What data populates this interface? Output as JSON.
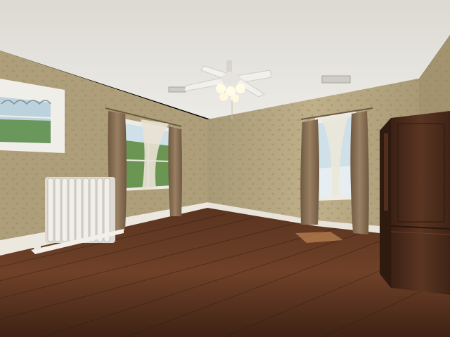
{
  "scene": {
    "description_kind": "photo",
    "colors": {
      "ceiling": "#e9e7e2",
      "ceiling_shadow": "#d6d3cc",
      "wallpaper": "#b3a582",
      "wallpaper_dark": "#9d8f6c",
      "baseboard": "#ece8de",
      "floor_light": "#8a5a3a",
      "floor_dark": "#3d2314",
      "curtain": "#8d7457",
      "sheer": "#e8e2d4",
      "window_glass": "#cfe0e8",
      "foliage": "#5d8a42",
      "radiator": "#e6e3dc",
      "armoire": "#4a2c1c",
      "fan_white": "#f2f0ec"
    }
  }
}
